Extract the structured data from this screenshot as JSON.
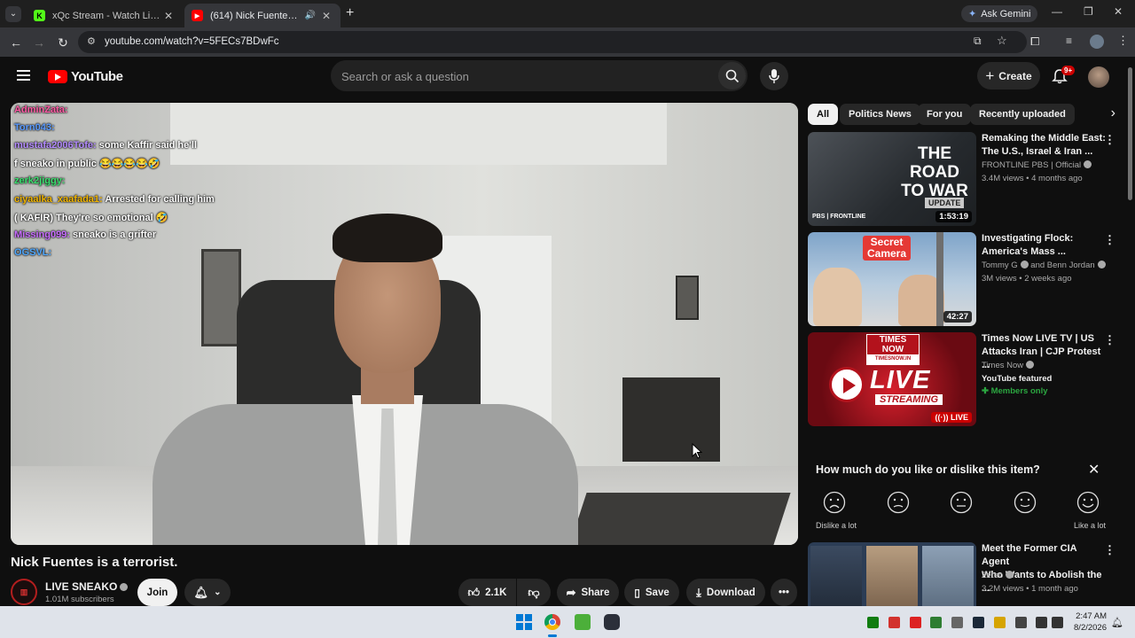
{
  "tabs": [
    {
      "title": "xQc Stream - Watch Live on Kick",
      "favicon": "K"
    },
    {
      "title": "(614) Nick Fuentes is a terrorist.",
      "favicon": "▶"
    }
  ],
  "gemini_label": "Ask Gemini",
  "address": {
    "url": "youtube.com/watch?v=5FECs7BDwFc"
  },
  "yt": {
    "logo_text": "YouTube",
    "search_placeholder": "Search or ask a question",
    "create_label": "Create",
    "notif_badge": "9+"
  },
  "chat": [
    {
      "user": "AdminZata:",
      "msg": "",
      "color": "#ff5aa5"
    },
    {
      "user": "Torn043:",
      "msg": "",
      "color": "#5b9bff"
    },
    {
      "user": "mustafa2006Tofe:",
      "msg": "some Kaffir said he'll",
      "color": "#b48cff"
    },
    {
      "user": "",
      "msg": "f sneako in public 😂😂😂😂🤣",
      "color": "#ffffff"
    },
    {
      "user": "zerk2jiggy:",
      "msg": "",
      "color": "#39e06e"
    },
    {
      "user": "ciyaalka_xaafada1:",
      "msg": "Arrested for calling him",
      "color": "#f0b400"
    },
    {
      "user": "",
      "msg": "( KAFIR) They're so emotional 🤣",
      "color": "#ffffff"
    },
    {
      "user": "Missing099:",
      "msg": "sneako is a grifter",
      "color": "#c86cff"
    },
    {
      "user": "OGSVL:",
      "msg": "",
      "color": "#4fa8ff"
    }
  ],
  "video": {
    "title": "Nick Fuentes is a terrorist.",
    "channel": "LIVE SNEAKO",
    "subscribers": "1.01M subscribers",
    "join_label": "Join",
    "likes": "2.1K",
    "share_label": "Share",
    "save_label": "Save",
    "download_label": "Download"
  },
  "chips": [
    "All",
    "Politics News",
    "For you",
    "Recently uploaded"
  ],
  "recommendations": [
    {
      "title_line1": "Remaking the Middle East:",
      "title_line2": "The U.S., Israel & Iran ...",
      "channel": "FRONTLINE PBS | Official",
      "meta": "3.4M views • 4 months ago",
      "duration": "1:53:19",
      "thumb_text1": "THE ROAD",
      "thumb_text2": "TO WAR",
      "thumb_tag": "UPDATE",
      "thumb_logo": "PBS | FRONTLINE"
    },
    {
      "title_line1": "Investigating Flock:",
      "title_line2": "America's Mass ...",
      "channel": "Tommy G",
      "channel2": "and Benn Jordan",
      "meta": "3M views • 2 weeks ago",
      "duration": "42:27",
      "thumb_text1": "Secret",
      "thumb_text2": "Camera"
    },
    {
      "title_line1": "Times Now LIVE TV | US",
      "title_line2": "Attacks Iran | CJP Protest ...",
      "channel": "Times Now",
      "featured": "YouTube featured",
      "members": "Members only",
      "live_badge": "LIVE",
      "thumb_text1": "TIMES",
      "thumb_text2": "NOW",
      "thumb_sub": "TIMESNOW.IN",
      "thumb_big": "LIVE",
      "thumb_stream": "STREAMING"
    },
    {
      "title_line1": "Meet the Former CIA Agent",
      "title_line2": "Who Wants to Abolish the ...",
      "channel": "Zeteo",
      "meta": "3.2M views • 1 month ago"
    }
  ],
  "survey": {
    "question": "How much do you like or dislike this item?",
    "left_label": "Dislike a lot",
    "right_label": "Like a lot"
  },
  "clock": {
    "time": "2:47 AM",
    "date": "8/2/2026"
  }
}
